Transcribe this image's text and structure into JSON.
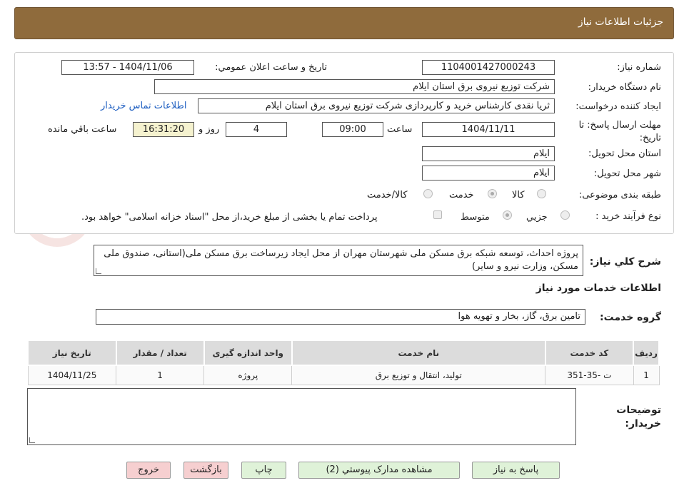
{
  "header": {
    "title": "جزئيات اطلاعات نیاز"
  },
  "form": {
    "need_number_label": "شماره نیاز:",
    "need_number": "1104001427000243",
    "announce_label": "تاریخ و ساعت اعلان عمومي:",
    "announce_value": "1404/11/06 - 13:57",
    "buyer_org_label": "نام دستگاه خريدار:",
    "buyer_org": "شركت توزيع نيروی برق استان ايلام",
    "requester_label": "ايجاد كننده درخواست:",
    "requester": "ثريا نقدی كارشناس خريد و كارپردازی شركت توزيع نيروی برق استان ايلام",
    "contact_link": "اطلاعات تماس خریدار",
    "deadline_label": "مهلت ارسال پاسخ: تا تاريخ:",
    "deadline_date": "1404/11/11",
    "time_label": "ساعت",
    "deadline_time": "09:00",
    "days_value": "4",
    "days_label": "روز و",
    "remaining_time": "16:31:20",
    "remaining_label": "ساعت باقي مانده",
    "province_label": "استان محل تحويل:",
    "province": "ايلام",
    "city_label": "شهر محل تحويل:",
    "city": "ايلام",
    "category_label": "طبقه بندی موضوعی:",
    "category_options": [
      "كالا",
      "خدمت",
      "كالا/خدمت"
    ],
    "process_label": "نوع فرآيند خريد :",
    "process_options": [
      "جزيي",
      "متوسط"
    ],
    "payment_note": "پرداخت تمام یا بخشی از مبلغ خرید،از محل \"اسناد خزانه اسلامی\" خواهد بود.",
    "description_label": "شرح كلي نياز:",
    "description": "پروژه احداث، توسعه شبکه برق مسکن ملی شهرستان مهران از محل ایجاد زیرساخت برق مسکن ملی(استانی، صندوق ملی مسکن، وزارت نیرو و سایر)"
  },
  "services": {
    "section_title": "اطلاعات خدمات مورد نياز",
    "group_label": "گروه خدمت:",
    "group_value": "تامين برق، گاز، بخار و تهويه هوا",
    "columns": [
      "رديف",
      "كد خدمت",
      "نام خدمت",
      "واحد اندازه گيری",
      "تعداد / مقدار",
      "تاريخ نياز"
    ],
    "rows": [
      [
        "1",
        "ت -35-351",
        "توليد، انتقال و توزيع برق",
        "پروژه",
        "1",
        "1404/11/25"
      ]
    ]
  },
  "buyer_notes_label": "توضيحات خريدار:",
  "buyer_notes": "",
  "buttons": {
    "reply": "پاسخ به نياز",
    "attachments": "مشاهده مدارک پيوستي (2)",
    "print": "چاپ",
    "back": "بازگشت",
    "exit": "خروج"
  },
  "watermark_text": "AriaTender.neT",
  "colors": {
    "header_bg": "#8f6b3c",
    "link": "#1f5fc1",
    "green_button": "#dff2d8",
    "pink_button": "#f6cfd0"
  }
}
